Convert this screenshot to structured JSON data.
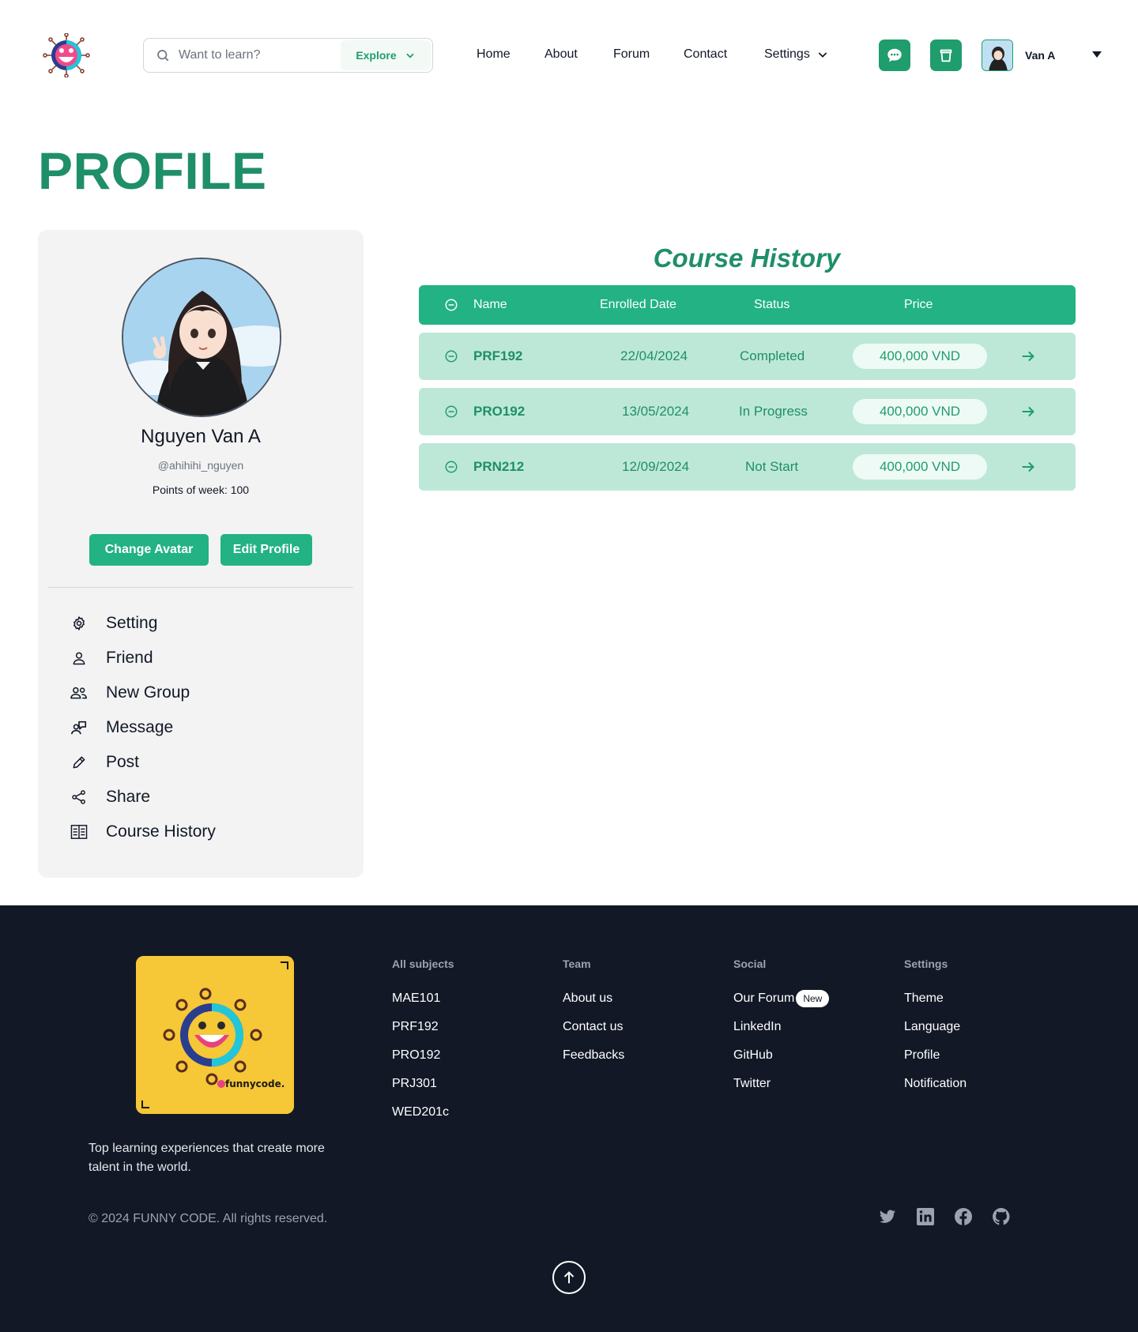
{
  "header": {
    "search": {
      "placeholder": "Want to learn?",
      "explore_label": "Explore"
    },
    "nav": {
      "home": "Home",
      "about": "About",
      "forum": "Forum",
      "contact": "Contact",
      "settings": "Settings"
    },
    "user": {
      "name": "Van A"
    }
  },
  "page": {
    "title": "PROFILE"
  },
  "profile": {
    "full_name": "Nguyen Van A",
    "handle": "@ahihihi_nguyen",
    "points": "Points of week: 100",
    "change_avatar_label": "Change  Avatar",
    "edit_profile_label": "Edit Profile",
    "menu": [
      {
        "label": "Setting",
        "icon": "gear-icon"
      },
      {
        "label": "Friend",
        "icon": "user-icon"
      },
      {
        "label": "New Group",
        "icon": "users-icon"
      },
      {
        "label": "Message",
        "icon": "message-icon"
      },
      {
        "label": "Post",
        "icon": "pencil-icon"
      },
      {
        "label": "Share",
        "icon": "share-icon"
      },
      {
        "label": "Course History",
        "icon": "book-icon"
      }
    ]
  },
  "course_history": {
    "title": "Course History",
    "columns": {
      "name": "Name",
      "enrolled": "Enrolled Date",
      "status": "Status",
      "price": "Price"
    },
    "rows": [
      {
        "name": "PRF192",
        "date": "22/04/2024",
        "status": "Completed",
        "price": "400,000 VND"
      },
      {
        "name": "PRO192",
        "date": "13/05/2024",
        "status": "In Progress",
        "price": "400,000 VND"
      },
      {
        "name": "PRN212",
        "date": "12/09/2024",
        "status": "Not Start",
        "price": "400,000 VND"
      }
    ]
  },
  "footer": {
    "tagline": "Top learning experiences that create more talent in the world.",
    "copyright": "© 2024 FUNNY CODE. All rights reserved.",
    "logo_text": "funnycode.",
    "columns": {
      "subjects": {
        "heading": "All subjects",
        "links": [
          "MAE101",
          "PRF192",
          "PRO192",
          "PRJ301",
          "WED201c"
        ]
      },
      "team": {
        "heading": "Team",
        "links": [
          "About us",
          "Contact us",
          "Feedbacks"
        ]
      },
      "social": {
        "heading": "Social",
        "links": [
          "Our Forum",
          "LinkedIn",
          "GitHub",
          "Twitter"
        ],
        "new_badge": "New"
      },
      "settings": {
        "heading": "Settings",
        "links": [
          "Theme",
          "Language",
          "Profile",
          "Notification"
        ]
      }
    }
  },
  "colors": {
    "brand_green": "#1f9d6d",
    "row_bg": "#bde8d8",
    "footer_bg": "#121826"
  }
}
